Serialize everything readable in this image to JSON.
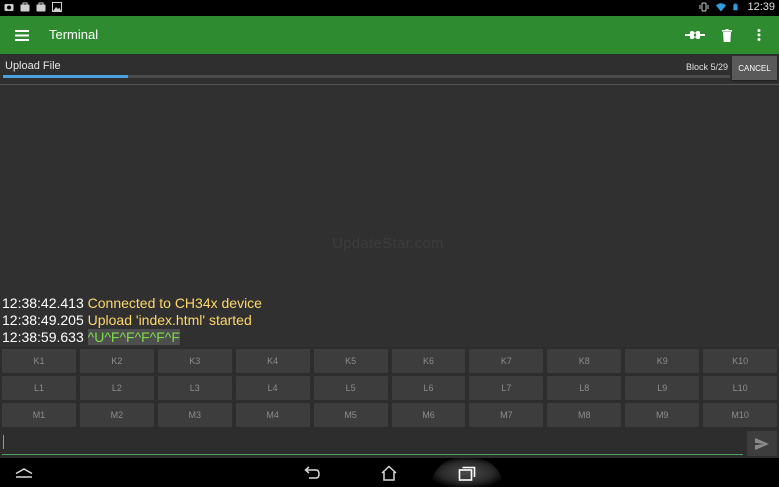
{
  "status_bar": {
    "time": "12:39",
    "left_icons": [
      "camera-icon",
      "briefcase-icon",
      "briefcase-icon",
      "image-icon"
    ],
    "right_icons": [
      "vibrate-icon",
      "wifi-icon",
      "battery-icon"
    ]
  },
  "app_bar": {
    "title": "Terminal",
    "background": "#2e8b2f",
    "actions": [
      "connect-icon",
      "delete-icon",
      "overflow-menu-icon"
    ]
  },
  "upload": {
    "label": "Upload File",
    "block_info": "Block 5/29",
    "cancel_label": "CANCEL",
    "progress_fraction": 0.1724
  },
  "terminal": {
    "watermark": "UpdateStar.com",
    "lines": [
      {
        "timestamp": "12:38:42.413",
        "text": "Connected to CH34x device",
        "kind": "status"
      },
      {
        "timestamp": "12:38:49.205",
        "text": "Upload 'index.html' started",
        "kind": "status"
      },
      {
        "timestamp": "12:38:59.633",
        "text": "^U^F^F^F^F^F",
        "kind": "received"
      }
    ],
    "colors": {
      "timestamp": "#ffffff",
      "status": "#ffd86a",
      "received": "#7cdc46"
    }
  },
  "keys": {
    "rows": [
      [
        "K1",
        "K2",
        "K3",
        "K4",
        "K5",
        "K6",
        "K7",
        "K8",
        "K9",
        "K10"
      ],
      [
        "L1",
        "L2",
        "L3",
        "L4",
        "L5",
        "L6",
        "L7",
        "L8",
        "L9",
        "L10"
      ],
      [
        "M1",
        "M2",
        "M3",
        "M4",
        "M5",
        "M6",
        "M7",
        "M8",
        "M9",
        "M10"
      ]
    ]
  },
  "input": {
    "value": "",
    "placeholder": ""
  },
  "nav_bar": {
    "buttons": [
      "collapse-icon",
      "back-icon",
      "home-icon",
      "recents-icon"
    ]
  }
}
